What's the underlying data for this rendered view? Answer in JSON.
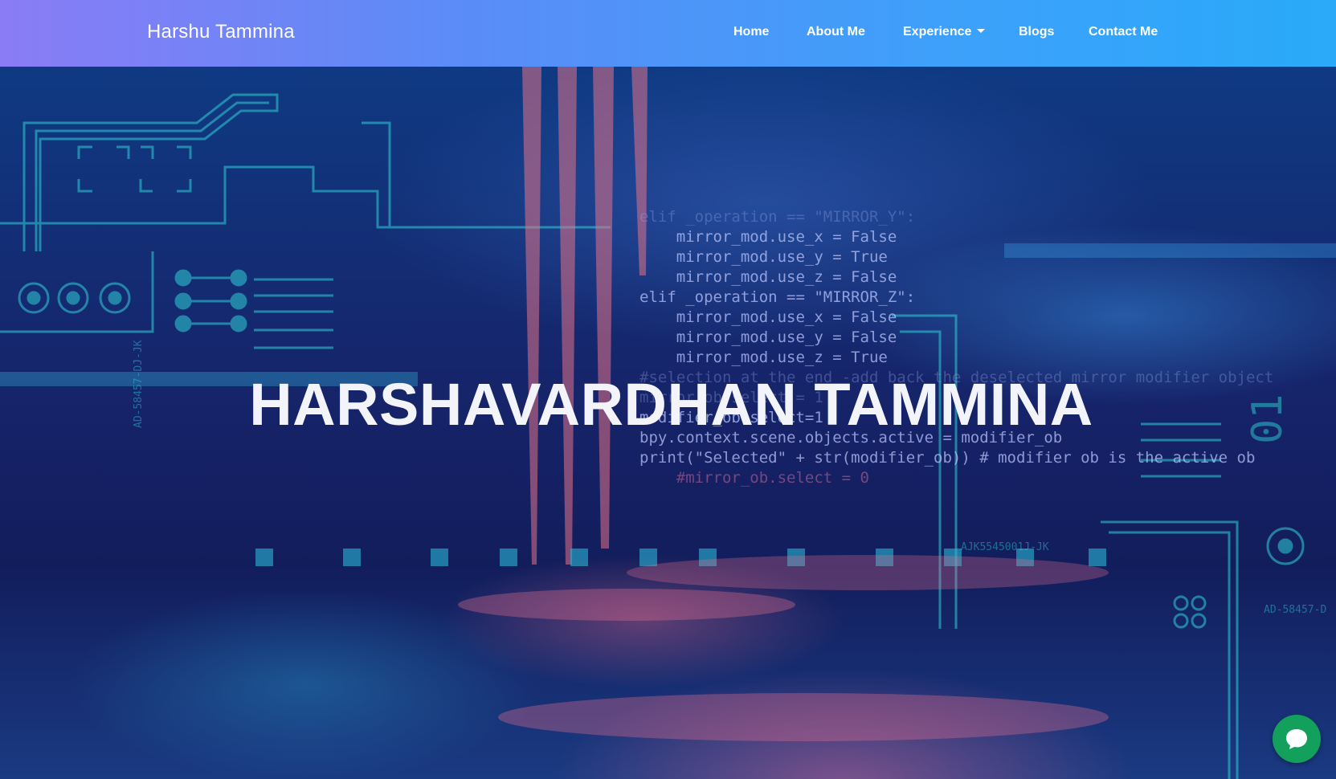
{
  "navbar": {
    "brand": "Harshu Tammina",
    "links": [
      {
        "label": "Home"
      },
      {
        "label": "About Me"
      },
      {
        "label": "Experience",
        "dropdown": true
      },
      {
        "label": "Blogs"
      },
      {
        "label": "Contact Me"
      }
    ],
    "gradient_colors": [
      "#8a7cf5",
      "#29aaf9"
    ]
  },
  "hero": {
    "title": "HARSHAVARDHAN TAMMINA",
    "code_lines": [
      "elif _operation == \"MIRROR_Y\":",
      "    mirror_mod.use_x = False",
      "    mirror_mod.use_y = True",
      "    mirror_mod.use_z = False",
      "elif _operation == \"MIRROR_Z\":",
      "    mirror_mod.use_x = False",
      "    mirror_mod.use_y = False",
      "    mirror_mod.use_z = True",
      "#selection at the end -add back the deselected mirror modifier object",
      "mirror_ob.select = 1",
      "modifier_ob.select=1",
      "bpy.context.scene.objects.active = modifier_ob",
      "print(\"Selected\" + str(modifier_ob)) # modifier ob is the active ob",
      "    #mirror_ob.select = 0"
    ],
    "circuit_labels": [
      "AD-58457-DJ-JK",
      "AJK5545001J-JK",
      "AD-58457-D",
      "01"
    ]
  },
  "chat_widget": {
    "icon": "chat-bubble-icon",
    "color": "#13a05c"
  }
}
